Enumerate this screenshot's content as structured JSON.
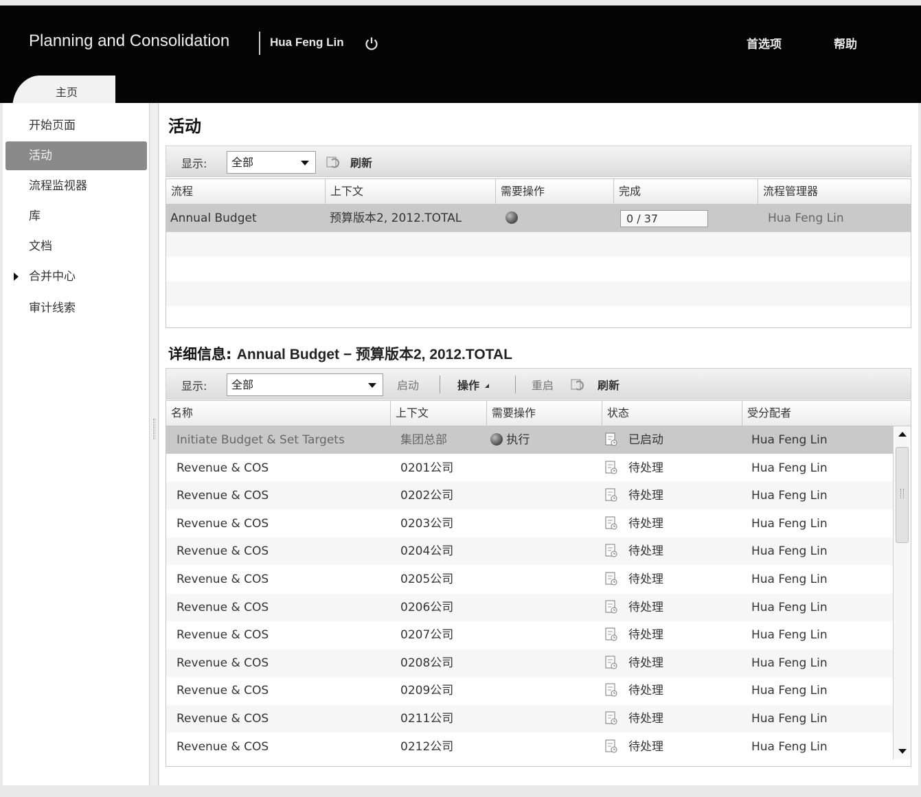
{
  "header": {
    "app_title": "Planning and Consolidation",
    "user": "Hua Feng Lin",
    "preferences": "首选项",
    "help": "帮助",
    "tab_home": "主页"
  },
  "sidebar": {
    "items": [
      {
        "label": "开始页面"
      },
      {
        "label": "活动"
      },
      {
        "label": "流程监视器"
      },
      {
        "label": "库"
      },
      {
        "label": "文档"
      },
      {
        "label": "合并中心"
      },
      {
        "label": "审计线索"
      }
    ]
  },
  "activities": {
    "title": "活动",
    "toolbar": {
      "show_label": "显示:",
      "show_value": "全部",
      "refresh": "刷新"
    },
    "columns": [
      "流程",
      "上下文",
      "需要操作",
      "完成",
      "流程管理器"
    ],
    "rows": [
      {
        "process": "Annual Budget",
        "context": "预算版本2, 2012.TOTAL",
        "completion": "0 / 37",
        "manager": "Hua Feng Lin"
      }
    ]
  },
  "details": {
    "title_prefix": "详细信息:",
    "title_rest": "Annual Budget − 预算版本2, 2012.TOTAL",
    "toolbar": {
      "show_label": "显示:",
      "show_value": "全部",
      "start": "启动",
      "actions": "操作",
      "reopen": "重启",
      "refresh": "刷新"
    },
    "columns": [
      "名称",
      "上下文",
      "需要操作",
      "状态",
      "受分配者"
    ],
    "rows": [
      {
        "name": "Initiate Budget & Set Targets",
        "context": "集团总部",
        "action": "执行",
        "status": "已启动",
        "assignee": "Hua Feng Lin"
      },
      {
        "name": "Revenue & COS",
        "context": "0201公司",
        "action": "",
        "status": "待处理",
        "assignee": "Hua Feng Lin"
      },
      {
        "name": "Revenue & COS",
        "context": "0202公司",
        "action": "",
        "status": "待处理",
        "assignee": "Hua Feng Lin"
      },
      {
        "name": "Revenue & COS",
        "context": "0203公司",
        "action": "",
        "status": "待处理",
        "assignee": "Hua Feng Lin"
      },
      {
        "name": "Revenue & COS",
        "context": "0204公司",
        "action": "",
        "status": "待处理",
        "assignee": "Hua Feng Lin"
      },
      {
        "name": "Revenue & COS",
        "context": "0205公司",
        "action": "",
        "status": "待处理",
        "assignee": "Hua Feng Lin"
      },
      {
        "name": "Revenue & COS",
        "context": "0206公司",
        "action": "",
        "status": "待处理",
        "assignee": "Hua Feng Lin"
      },
      {
        "name": "Revenue & COS",
        "context": "0207公司",
        "action": "",
        "status": "待处理",
        "assignee": "Hua Feng Lin"
      },
      {
        "name": "Revenue & COS",
        "context": "0208公司",
        "action": "",
        "status": "待处理",
        "assignee": "Hua Feng Lin"
      },
      {
        "name": "Revenue & COS",
        "context": "0209公司",
        "action": "",
        "status": "待处理",
        "assignee": "Hua Feng Lin"
      },
      {
        "name": "Revenue & COS",
        "context": "0211公司",
        "action": "",
        "status": "待处理",
        "assignee": "Hua Feng Lin"
      },
      {
        "name": "Revenue & COS",
        "context": "0212公司",
        "action": "",
        "status": "待处理",
        "assignee": "Hua Feng Lin"
      }
    ]
  }
}
